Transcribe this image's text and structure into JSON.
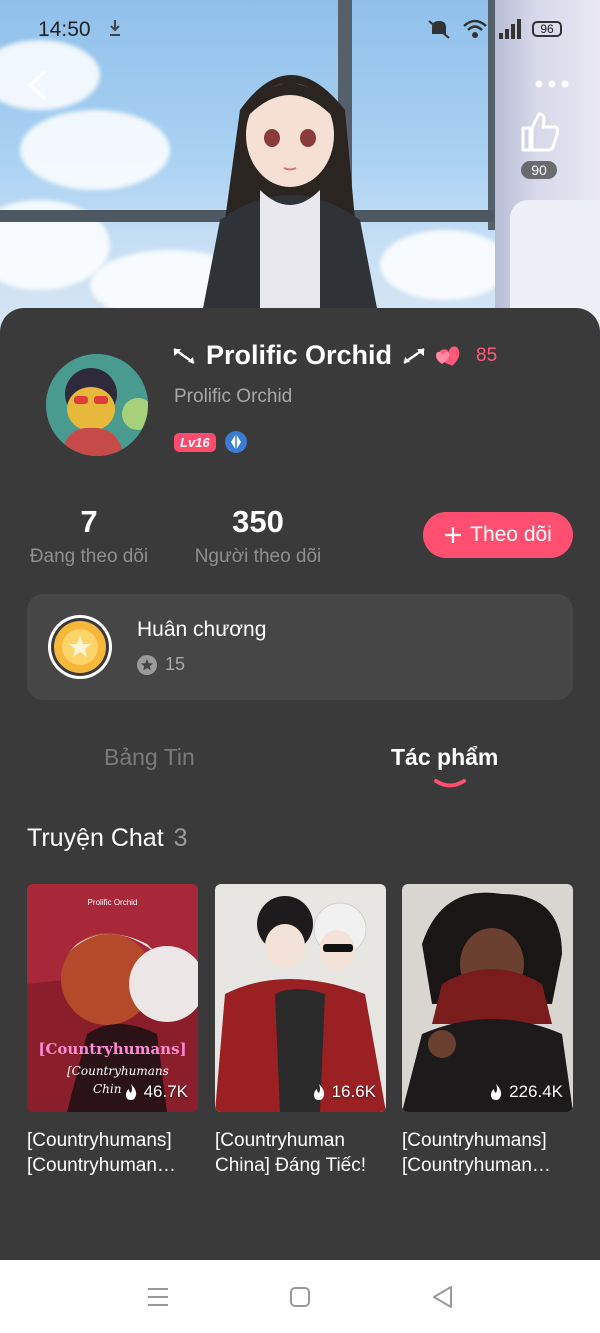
{
  "status_bar": {
    "time": "14:50",
    "battery": "96"
  },
  "header": {
    "like_count": "90"
  },
  "profile": {
    "name": "Prolific Orchid",
    "hearts": "85",
    "handle": "Prolific Orchid",
    "level": "Lv16"
  },
  "stats": {
    "following_count": "7",
    "following_label": "Đang theo dõi",
    "followers_count": "350",
    "followers_label": "Người theo dõi"
  },
  "follow_button": {
    "label": "Theo dõi",
    "icon": "plus-icon"
  },
  "medals": {
    "title": "Huân chương",
    "count": "15"
  },
  "tabs": [
    {
      "label": "Bảng Tin",
      "active": false
    },
    {
      "label": "Tác phẩm",
      "active": true
    }
  ],
  "section": {
    "title": "Truyện Chat",
    "count": "3"
  },
  "stories": [
    {
      "title": "[Countryhumans] [Countryhuman…",
      "views": "46.7K",
      "cover_text_top": "Prolific Orchid",
      "cover_text_main": "[Countryhumans]",
      "cover_text_sub": "[Countryhumans",
      "cover_text_sub2": "Chin"
    },
    {
      "title": "[Countryhuman China] Đáng Tiếc!",
      "views": "16.6K"
    },
    {
      "title": "[Countryhumans] [Countryhuman…",
      "views": "226.4K"
    }
  ],
  "colors": {
    "accent": "#ff4f70",
    "background": "#3a3a3a",
    "card": "#464646"
  }
}
